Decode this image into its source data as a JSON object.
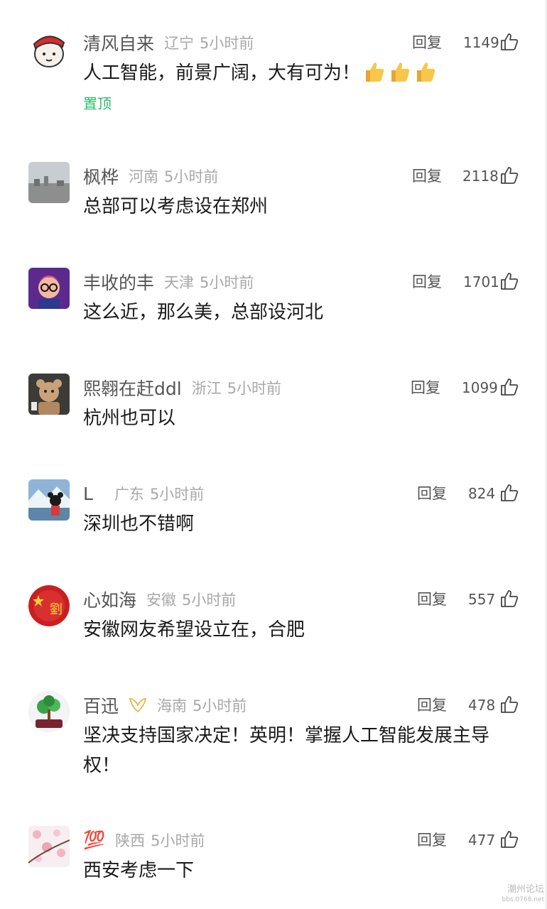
{
  "reply_label": "回复",
  "pinned_label": "置顶",
  "accent_color": "#2dbb6b",
  "comments": [
    {
      "user": "清风自来",
      "location": "辽宁",
      "time": "5小时前",
      "likes": "1149",
      "text": "人工智能，前景广阔，大有可为！"
    },
    {
      "user": "枫桦",
      "location": "河南",
      "time": "5小时前",
      "likes": "2118",
      "text": "总部可以考虑设在郑州"
    },
    {
      "user": "丰收的丰",
      "location": "天津",
      "time": "5小时前",
      "likes": "1701",
      "text": "这么近，那么美，总部设河北"
    },
    {
      "user": "熙翱在赶ddl",
      "location": "浙江",
      "time": "5小时前",
      "likes": "1099",
      "text": "杭州也可以"
    },
    {
      "user": "L",
      "location": "广东",
      "time": "5小时前",
      "likes": "824",
      "text": "深圳也不错啊"
    },
    {
      "user": "心如海",
      "location": "安徽",
      "time": "5小时前",
      "likes": "557",
      "text": "安徽网友希望设立在，合肥"
    },
    {
      "user": "百迅",
      "location": "海南",
      "time": "5小时前",
      "likes": "478",
      "text": "坚决支持国家决定！英明！掌握人工智能发展主导权！"
    },
    {
      "user": "💯",
      "location": "陕西",
      "time": "5小时前",
      "likes": "477",
      "text": "西安考虑一下"
    }
  ],
  "watermark": {
    "line1": "潮州论坛",
    "line2": "bbs.0768.net"
  }
}
